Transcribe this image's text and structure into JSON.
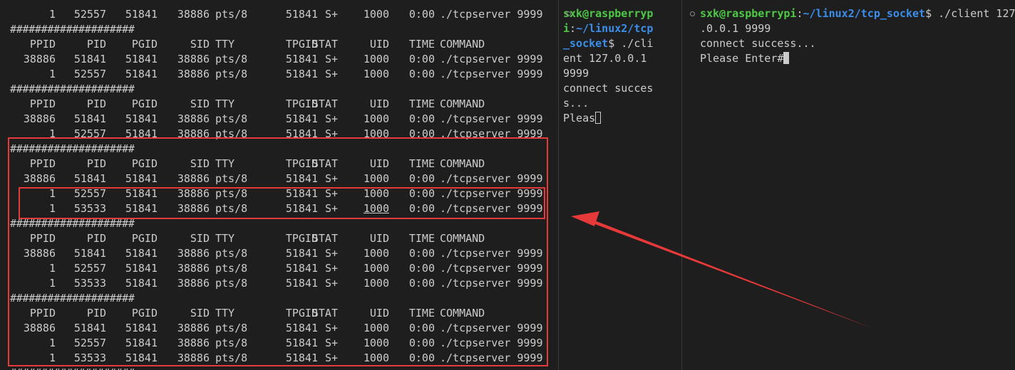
{
  "annotation_color": "#e5393a",
  "left_terminal": {
    "lines": [
      {
        "type": "row",
        "cols": [
          "1",
          "52557",
          "51841",
          "38886",
          "pts/8",
          "51841",
          "S+",
          "1000",
          "0:00",
          "./tcpserver 9999"
        ]
      },
      {
        "type": "sep",
        "text": "####################"
      },
      {
        "type": "row",
        "cols": [
          "PPID",
          "PID",
          "PGID",
          "SID",
          "TTY",
          "TPGID",
          "STAT",
          "UID",
          "TIME",
          "COMMAND"
        ]
      },
      {
        "type": "row",
        "cols": [
          "38886",
          "51841",
          "51841",
          "38886",
          "pts/8",
          "51841",
          "S+",
          "1000",
          "0:00",
          "./tcpserver 9999"
        ]
      },
      {
        "type": "row",
        "cols": [
          "1",
          "52557",
          "51841",
          "38886",
          "pts/8",
          "51841",
          "S+",
          "1000",
          "0:00",
          "./tcpserver 9999"
        ]
      },
      {
        "type": "sep",
        "text": "####################"
      },
      {
        "type": "row",
        "cols": [
          "PPID",
          "PID",
          "PGID",
          "SID",
          "TTY",
          "TPGID",
          "STAT",
          "UID",
          "TIME",
          "COMMAND"
        ]
      },
      {
        "type": "row",
        "cols": [
          "38886",
          "51841",
          "51841",
          "38886",
          "pts/8",
          "51841",
          "S+",
          "1000",
          "0:00",
          "./tcpserver 9999"
        ]
      },
      {
        "type": "row",
        "cols": [
          "1",
          "52557",
          "51841",
          "38886",
          "pts/8",
          "51841",
          "S+",
          "1000",
          "0:00",
          "./tcpserver 9999"
        ]
      },
      {
        "type": "sep",
        "text": "####################"
      },
      {
        "type": "row",
        "cols": [
          "PPID",
          "PID",
          "PGID",
          "SID",
          "TTY",
          "TPGID",
          "STAT",
          "UID",
          "TIME",
          "COMMAND"
        ]
      },
      {
        "type": "row",
        "cols": [
          "38886",
          "51841",
          "51841",
          "38886",
          "pts/8",
          "51841",
          "S+",
          "1000",
          "0:00",
          "./tcpserver 9999"
        ]
      },
      {
        "type": "row",
        "cols": [
          "1",
          "52557",
          "51841",
          "38886",
          "pts/8",
          "51841",
          "S+",
          "1000",
          "0:00",
          "./tcpserver 9999"
        ]
      },
      {
        "type": "row",
        "uid_underline": true,
        "cols": [
          "1",
          "53533",
          "51841",
          "38886",
          "pts/8",
          "51841",
          "S+",
          "1000",
          "0:00",
          "./tcpserver 9999"
        ]
      },
      {
        "type": "sep",
        "text": "####################"
      },
      {
        "type": "row",
        "cols": [
          "PPID",
          "PID",
          "PGID",
          "SID",
          "TTY",
          "TPGID",
          "STAT",
          "UID",
          "TIME",
          "COMMAND"
        ]
      },
      {
        "type": "row",
        "cols": [
          "38886",
          "51841",
          "51841",
          "38886",
          "pts/8",
          "51841",
          "S+",
          "1000",
          "0:00",
          "./tcpserver 9999"
        ]
      },
      {
        "type": "row",
        "cols": [
          "1",
          "52557",
          "51841",
          "38886",
          "pts/8",
          "51841",
          "S+",
          "1000",
          "0:00",
          "./tcpserver 9999"
        ]
      },
      {
        "type": "row",
        "cols": [
          "1",
          "53533",
          "51841",
          "38886",
          "pts/8",
          "51841",
          "S+",
          "1000",
          "0:00",
          "./tcpserver 9999"
        ]
      },
      {
        "type": "sep",
        "text": "####################"
      },
      {
        "type": "row",
        "cols": [
          "PPID",
          "PID",
          "PGID",
          "SID",
          "TTY",
          "TPGID",
          "STAT",
          "UID",
          "TIME",
          "COMMAND"
        ]
      },
      {
        "type": "row",
        "cols": [
          "38886",
          "51841",
          "51841",
          "38886",
          "pts/8",
          "51841",
          "S+",
          "1000",
          "0:00",
          "./tcpserver 9999"
        ]
      },
      {
        "type": "row",
        "cols": [
          "1",
          "52557",
          "51841",
          "38886",
          "pts/8",
          "51841",
          "S+",
          "1000",
          "0:00",
          "./tcpserver 9999"
        ]
      },
      {
        "type": "row",
        "cols": [
          "1",
          "53533",
          "51841",
          "38886",
          "pts/8",
          "51841",
          "S+",
          "1000",
          "0:00",
          "./tcpserver 9999"
        ]
      },
      {
        "type": "sep",
        "text": "####################"
      }
    ]
  },
  "middle_terminal": {
    "prompt_user": "sxk@raspberryp",
    "prompt_user_wrap": "i",
    "prompt_path_1": "~/linux2/tcp",
    "prompt_path_2": "_socket",
    "command_part_1": "$ ./cli",
    "command_part_2": "ent 127.0.0.1",
    "command_part_3": "9999",
    "output_1": "connect succes",
    "output_2": "s...",
    "output_3": "Pleas"
  },
  "right_terminal": {
    "prompt_user": "sxk@raspberrypi",
    "prompt_path": "~/linux2/tcp_socket",
    "command_part_1": "$ ./client 127",
    "command_part_2": ".0.0.1 9999",
    "output_1": "connect success...",
    "output_2": "Please Enter#"
  }
}
